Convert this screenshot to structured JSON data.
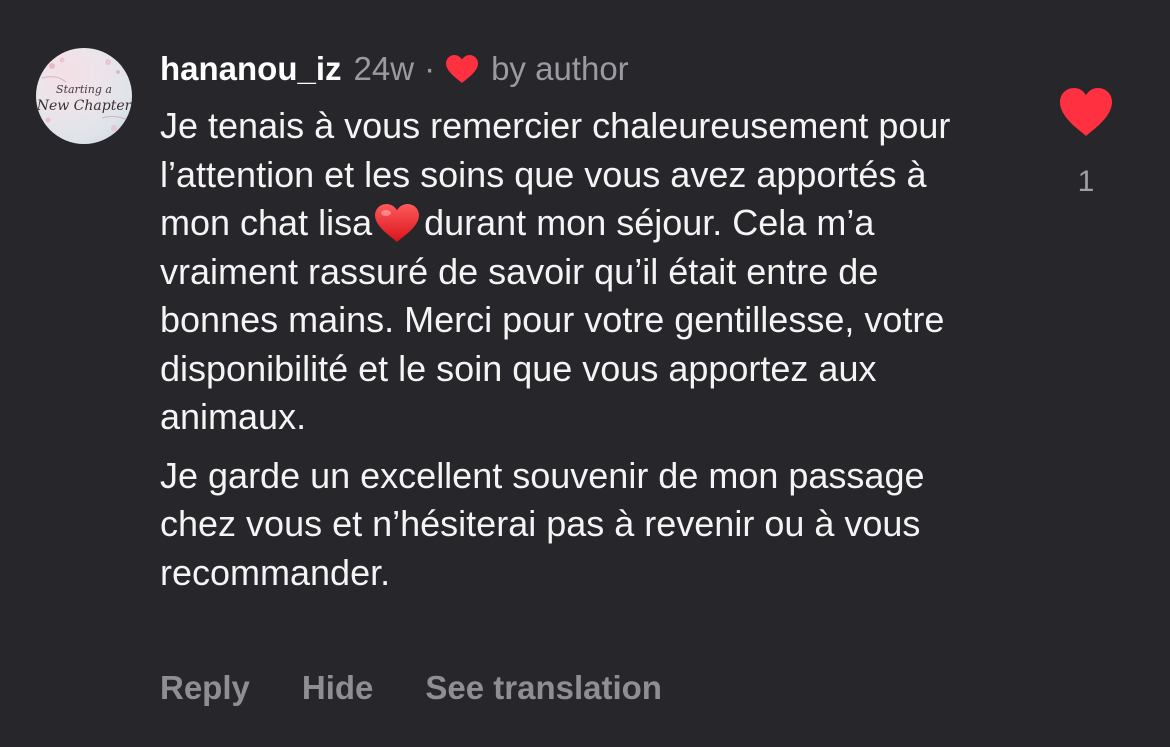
{
  "comment": {
    "avatar_text_line1": "Starting a",
    "avatar_text_line2": "New Chapter",
    "username": "hananou_iz",
    "time": "24w",
    "separator": "·",
    "liked_by_author_icon": "heart-icon",
    "by_author_label": "by author",
    "paragraph1": {
      "before_heart": "Je tenais à vous remercier chaleureusement pour l’attention et les soins que vous avez apportés à mon chat lisa",
      "heart_icon": "red-heart-emoji",
      "after_heart": "durant mon séjour. Cela m’a vraiment rassuré de savoir qu’il était entre de bonnes mains. Merci pour votre gentillesse, votre disponibilité et le soin que vous apportez aux animaux."
    },
    "paragraph2": "Je garde un excellent souvenir de mon passage chez vous et n’hésiterai pas à revenir ou à vous recommander.",
    "actions": {
      "reply": "Reply",
      "hide": "Hide",
      "see_translation": "See translation"
    },
    "like": {
      "icon": "heart-icon",
      "count": "1",
      "liked": true
    },
    "colors": {
      "background": "#26262b",
      "heart": "#ff3040",
      "muted_text": "#9a9aa0"
    }
  }
}
